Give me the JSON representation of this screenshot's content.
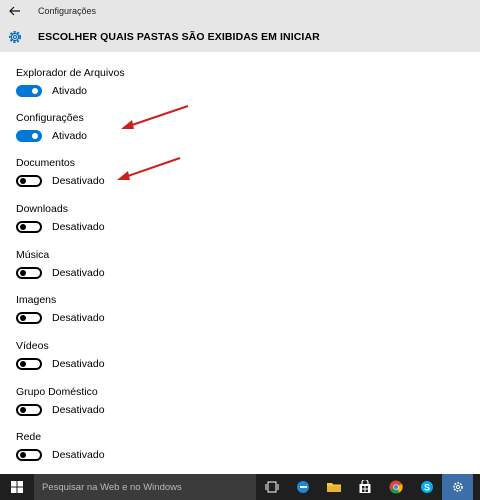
{
  "window": {
    "title": "Configurações"
  },
  "header": {
    "title": "ESCOLHER QUAIS PASTAS SÃO EXIBIDAS EM INICIAR"
  },
  "folders": [
    {
      "label": "Explorador de Arquivos",
      "state": "Ativado",
      "on": true
    },
    {
      "label": "Configurações",
      "state": "Ativado",
      "on": true
    },
    {
      "label": "Documentos",
      "state": "Desativado",
      "on": false
    },
    {
      "label": "Downloads",
      "state": "Desativado",
      "on": false
    },
    {
      "label": "Música",
      "state": "Desativado",
      "on": false
    },
    {
      "label": "Imagens",
      "state": "Desativado",
      "on": false
    },
    {
      "label": "Vídeos",
      "state": "Desativado",
      "on": false
    },
    {
      "label": "Grupo Doméstico",
      "state": "Desativado",
      "on": false
    },
    {
      "label": "Rede",
      "state": "Desativado",
      "on": false
    }
  ],
  "taskbar": {
    "search_placeholder": "Pesquisar na Web e no Windows",
    "icons": [
      "task-view-icon",
      "edge-icon",
      "file-explorer-icon",
      "store-icon",
      "chrome-icon",
      "skype-icon",
      "settings-icon"
    ]
  },
  "colors": {
    "accent": "#0078d7",
    "arrow": "#d01f1f",
    "taskbar": "#1f1f1f"
  }
}
